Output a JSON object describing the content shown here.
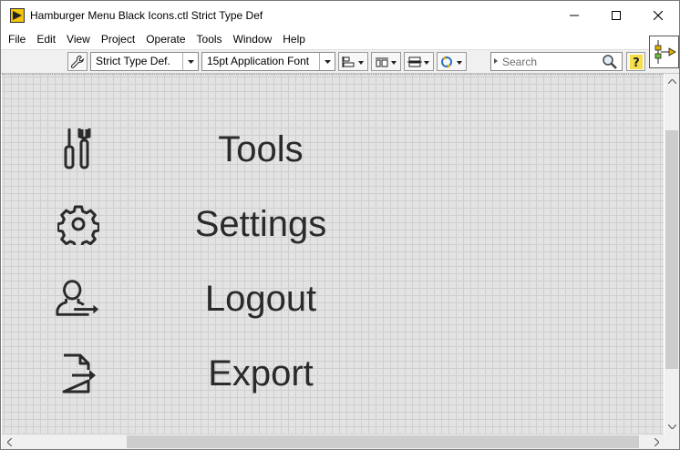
{
  "window": {
    "title": "Hamburger Menu Black Icons.ctl Strict Type Def"
  },
  "menubar": {
    "items": [
      "File",
      "Edit",
      "View",
      "Project",
      "Operate",
      "Tools",
      "Window",
      "Help"
    ]
  },
  "toolbar": {
    "type_def_value": "Strict Type Def.",
    "font_value": "15pt Application Font",
    "search_placeholder": "Search"
  },
  "canvas": {
    "items": [
      {
        "label": "Tools",
        "icon": "tools-icon"
      },
      {
        "label": "Settings",
        "icon": "gear-icon"
      },
      {
        "label": "Logout",
        "icon": "logout-icon"
      },
      {
        "label": "Export",
        "icon": "export-icon"
      }
    ],
    "label_color": "#2a2a2a",
    "grid_color": "#cfcfcf",
    "background_color": "#e3e3e3"
  }
}
